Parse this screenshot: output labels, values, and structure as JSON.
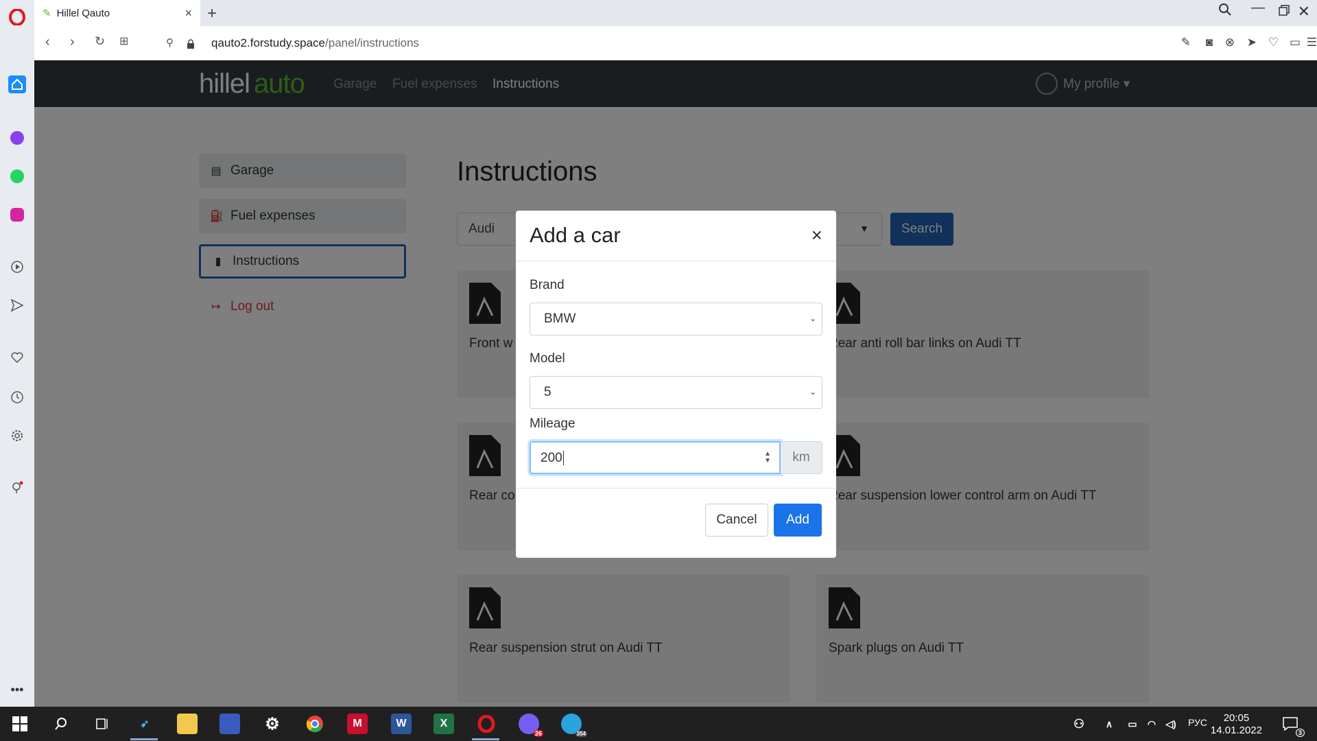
{
  "browser": {
    "tab_title": "Hillel Qauto",
    "tab_close": "×",
    "new_tab": "+",
    "url_host": "qauto2.forstudy.space",
    "url_path": "/panel/instructions"
  },
  "navbar": {
    "logo_hillel": "hillel",
    "logo_auto": "auto",
    "links": [
      "Garage",
      "Fuel expenses",
      "Instructions"
    ],
    "profile": "My profile ▾"
  },
  "sidebar": {
    "items": [
      "Garage",
      "Fuel expenses",
      "Instructions",
      "Log out"
    ]
  },
  "main": {
    "title": "Instructions",
    "brand_filter": "Audi",
    "search_label": "Search",
    "cards": [
      "Front w",
      "Rear anti roll bar links on Audi TT",
      "Rear co",
      "Rear suspension lower control arm on Audi TT",
      "Rear suspension strut on Audi TT",
      "Spark plugs on Audi TT"
    ]
  },
  "modal": {
    "title": "Add a car",
    "close": "×",
    "brand_label": "Brand",
    "brand_value": "BMW",
    "model_label": "Model",
    "model_value": "5",
    "mileage_label": "Mileage",
    "mileage_value": "200",
    "mileage_unit": "km",
    "cancel_label": "Cancel",
    "add_label": "Add"
  },
  "taskbar": {
    "lang": "РУС",
    "time": "20:05",
    "date": "14.01.2022",
    "viber_badge": "26",
    "telegram_badge": "354",
    "notifications": "3"
  }
}
